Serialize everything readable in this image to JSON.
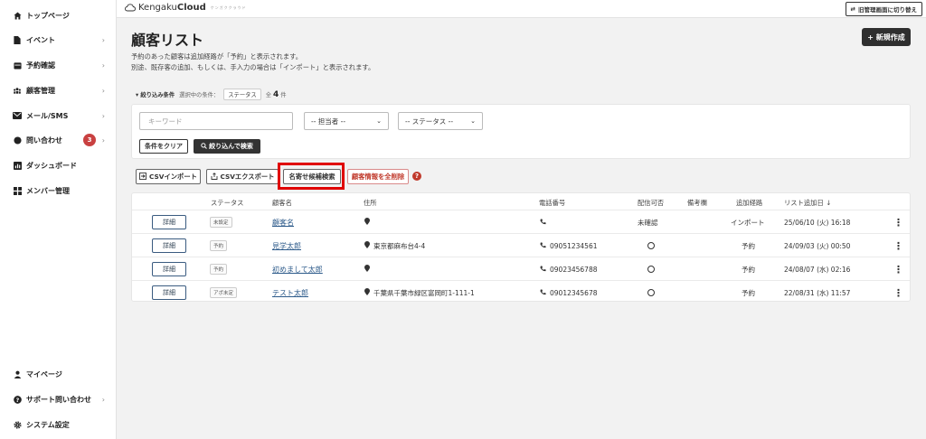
{
  "sidebar": {
    "items": [
      {
        "label": "トップページ",
        "icon": "home-icon",
        "chevron": false
      },
      {
        "label": "イベント",
        "icon": "document-icon",
        "chevron": true
      },
      {
        "label": "予約確認",
        "icon": "calendar-icon",
        "chevron": true
      },
      {
        "label": "顧客管理",
        "icon": "users-icon",
        "chevron": true
      },
      {
        "label": "メール/SMS",
        "icon": "mail-icon",
        "chevron": true
      },
      {
        "label": "問い合わせ",
        "icon": "chat-icon",
        "chevron": true,
        "badge": "3"
      },
      {
        "label": "ダッシュボード",
        "icon": "chart-icon",
        "chevron": false
      },
      {
        "label": "メンバー管理",
        "icon": "grid-icon",
        "chevron": false
      }
    ],
    "bottom_items": [
      {
        "label": "マイページ",
        "icon": "person-icon",
        "chevron": false
      },
      {
        "label": "サポート問い合わせ",
        "icon": "help-circle-icon",
        "chevron": true
      },
      {
        "label": "システム設定",
        "icon": "gear-icon",
        "chevron": false
      }
    ]
  },
  "topbar": {
    "logo_prefix": "Kengaku",
    "logo_bold": "Cloud",
    "logo_tag": "ケンガククラウド",
    "switch_label": "旧管理画面に切り替え"
  },
  "page": {
    "title": "顧客リスト",
    "desc_line1": "予約のあった顧客は追加経路が「予約」と表示されます。",
    "desc_line2": "別途、既存客の追加、もしくは、手入力の場合は「インポート」と表示されます。",
    "new_button": "+ 新規作成"
  },
  "filter": {
    "label": "▾ 絞り込み条件",
    "selected_label": "選択中の条件：",
    "selected_chip": "ステータス",
    "count_prefix": "全",
    "count": "4",
    "count_suffix": "件",
    "keyword_placeholder": "キーワード",
    "assignee_select": "-- 担当者 --",
    "status_select": "-- ステータス --",
    "clear_button": "条件をクリア",
    "search_button": "絞り込んで検索"
  },
  "actions": {
    "csv_import": "CSVインポート",
    "csv_export": "CSVエクスポート",
    "name_dedupe": "名寄せ候補検索",
    "delete_all": "顧客情報を全削除",
    "help": "?"
  },
  "table": {
    "headers": [
      "ステータス",
      "顧客名",
      "住所",
      "電話番号",
      "配信可否",
      "備考欄",
      "追加経路",
      "リスト追加日 ↓"
    ],
    "detail_label": "詳細",
    "rows": [
      {
        "status": "未設定",
        "name": "顧客名",
        "address": "",
        "phone": "",
        "deliverable": "未確認",
        "note": "",
        "route": "インポート",
        "added": "25/06/10 (火) 16:18"
      },
      {
        "status": "予約",
        "name": "見学太郎",
        "address": "東京都麻布台4-4",
        "phone": "09051234561",
        "deliverable": "○",
        "note": "",
        "route": "予約",
        "added": "24/09/03 (火) 00:50"
      },
      {
        "status": "予約",
        "name": "初めまして太郎",
        "address": "",
        "phone": "09023456788",
        "deliverable": "○",
        "note": "",
        "route": "予約",
        "added": "24/08/07 (水) 02:16"
      },
      {
        "status": "アポ未定",
        "name": "テスト太郎",
        "address": "千葉県千葉市緑区富岡町1-111-1",
        "phone": "09012345678",
        "deliverable": "○",
        "note": "",
        "route": "予約",
        "added": "22/08/31 (水) 11:57"
      }
    ]
  }
}
